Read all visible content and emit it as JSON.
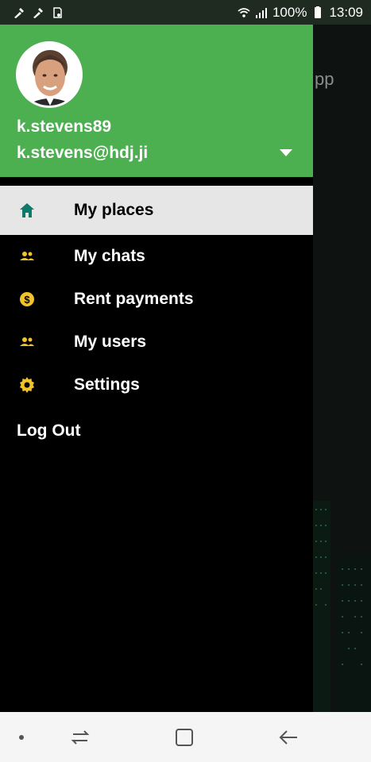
{
  "status_bar": {
    "battery": "100%",
    "time": "13:09",
    "icons": [
      "broom-icon",
      "broom-icon",
      "sdcard-icon",
      "wifi-icon",
      "signal-icon",
      "battery-icon"
    ]
  },
  "background_app": {
    "title_fragment": "pp"
  },
  "drawer": {
    "profile": {
      "username": "k.stevens89",
      "email": "k.stevens@hdj.ji"
    },
    "menu": [
      {
        "label": "My places",
        "icon": "home-icon",
        "active": true
      },
      {
        "label": "My chats",
        "icon": "people-icon",
        "active": false
      },
      {
        "label": "Rent payments",
        "icon": "dollar-coin-icon",
        "active": false
      },
      {
        "label": "My users",
        "icon": "people-icon",
        "active": false
      },
      {
        "label": "Settings",
        "icon": "gear-icon",
        "active": false
      }
    ],
    "logout_label": "Log Out"
  },
  "colors": {
    "header_green": "#4caf50",
    "active_home_icon": "#0d7a6b",
    "menu_icon_yellow": "#f2c22b",
    "active_row": "#e6e6e6"
  },
  "nav_bar": {
    "buttons": [
      "dot-icon",
      "recent-apps-icon",
      "home-square-icon",
      "back-arrow-icon"
    ]
  }
}
